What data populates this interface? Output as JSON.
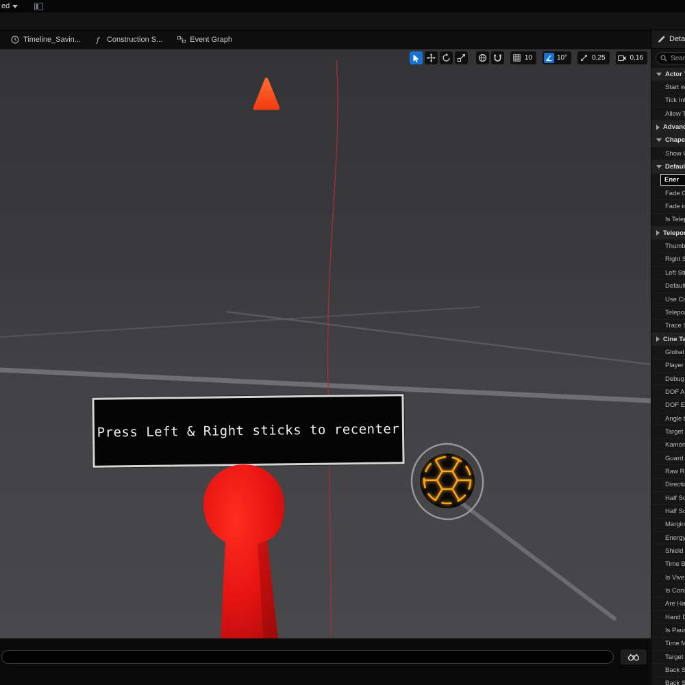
{
  "title_bar": {
    "dropdown_label": "ed"
  },
  "tabs": [
    {
      "label": "Timeline_Savin...",
      "icon": "clock-icon"
    },
    {
      "label": "Construction S...",
      "icon": "function-icon"
    },
    {
      "label": "Event Graph",
      "icon": "graph-icon"
    }
  ],
  "viewport": {
    "toolbar": {
      "grid_snap": "10",
      "angle_snap": "10°",
      "scale_snap": "0,25",
      "camera_speed": "0,16"
    },
    "sign_text": "Press Left & Right sticks to recenter",
    "colors": {
      "accent_blue": "#1673d2",
      "cone_red": "#e81616",
      "ball_glow": "#ffa51e",
      "sign_border": "#d6d6d6"
    }
  },
  "details_panel": {
    "title": "Detail",
    "search_placeholder": "Sear",
    "rows": [
      {
        "label": "Actor Tic",
        "kind": "category",
        "expanded": true
      },
      {
        "label": "Start wit",
        "kind": "prop"
      },
      {
        "label": "Tick Inte",
        "kind": "prop"
      },
      {
        "label": "Allow Ti",
        "kind": "prop"
      },
      {
        "label": "Advance",
        "kind": "category",
        "expanded": false
      },
      {
        "label": "Chapero",
        "kind": "category",
        "expanded": true
      },
      {
        "label": "Show Ch",
        "kind": "prop"
      },
      {
        "label": "Default",
        "kind": "category",
        "expanded": true
      },
      {
        "label": "Ener",
        "kind": "field"
      },
      {
        "label": "Fade Ou",
        "kind": "prop"
      },
      {
        "label": "Fade in",
        "kind": "prop"
      },
      {
        "label": "Is Telep",
        "kind": "prop"
      },
      {
        "label": "Teleport",
        "kind": "category",
        "expanded": false
      },
      {
        "label": "Thumb D",
        "kind": "prop"
      },
      {
        "label": "Right Sti",
        "kind": "prop"
      },
      {
        "label": "Left Stic",
        "kind": "prop"
      },
      {
        "label": "Default F",
        "kind": "prop"
      },
      {
        "label": "Use Con",
        "kind": "prop"
      },
      {
        "label": "Teleport",
        "kind": "prop"
      },
      {
        "label": "Trace Sp",
        "kind": "prop"
      },
      {
        "label": "Cine Tar",
        "kind": "category",
        "expanded": false
      },
      {
        "label": "Global T",
        "kind": "prop"
      },
      {
        "label": "Player C",
        "kind": "prop"
      },
      {
        "label": "Debug T",
        "kind": "prop"
      },
      {
        "label": "DOF An",
        "kind": "prop"
      },
      {
        "label": "DOF En",
        "kind": "prop"
      },
      {
        "label": "Angle to",
        "kind": "prop"
      },
      {
        "label": "Target F",
        "kind": "prop"
      },
      {
        "label": "Kamon",
        "kind": "prop"
      },
      {
        "label": "Guard A",
        "kind": "prop"
      },
      {
        "label": "Raw Ro",
        "kind": "prop"
      },
      {
        "label": "Directio",
        "kind": "prop"
      },
      {
        "label": "Half Scr",
        "kind": "prop"
      },
      {
        "label": "Half Scr",
        "kind": "prop"
      },
      {
        "label": "Margin",
        "kind": "prop"
      },
      {
        "label": "Energy",
        "kind": "prop"
      },
      {
        "label": "Shield L",
        "kind": "prop"
      },
      {
        "label": "Time Bo",
        "kind": "prop"
      },
      {
        "label": "Is Vive",
        "kind": "prop"
      },
      {
        "label": "Is Cons",
        "kind": "prop"
      },
      {
        "label": "Are Han",
        "kind": "prop"
      },
      {
        "label": "Hand Di",
        "kind": "prop"
      },
      {
        "label": "Is Paus",
        "kind": "prop"
      },
      {
        "label": "Time Mi",
        "kind": "prop"
      },
      {
        "label": "Target S",
        "kind": "prop"
      },
      {
        "label": "Back Sp",
        "kind": "prop"
      },
      {
        "label": "Back S",
        "kind": "prop"
      }
    ]
  },
  "bottom_bar": {
    "find_value": ""
  }
}
